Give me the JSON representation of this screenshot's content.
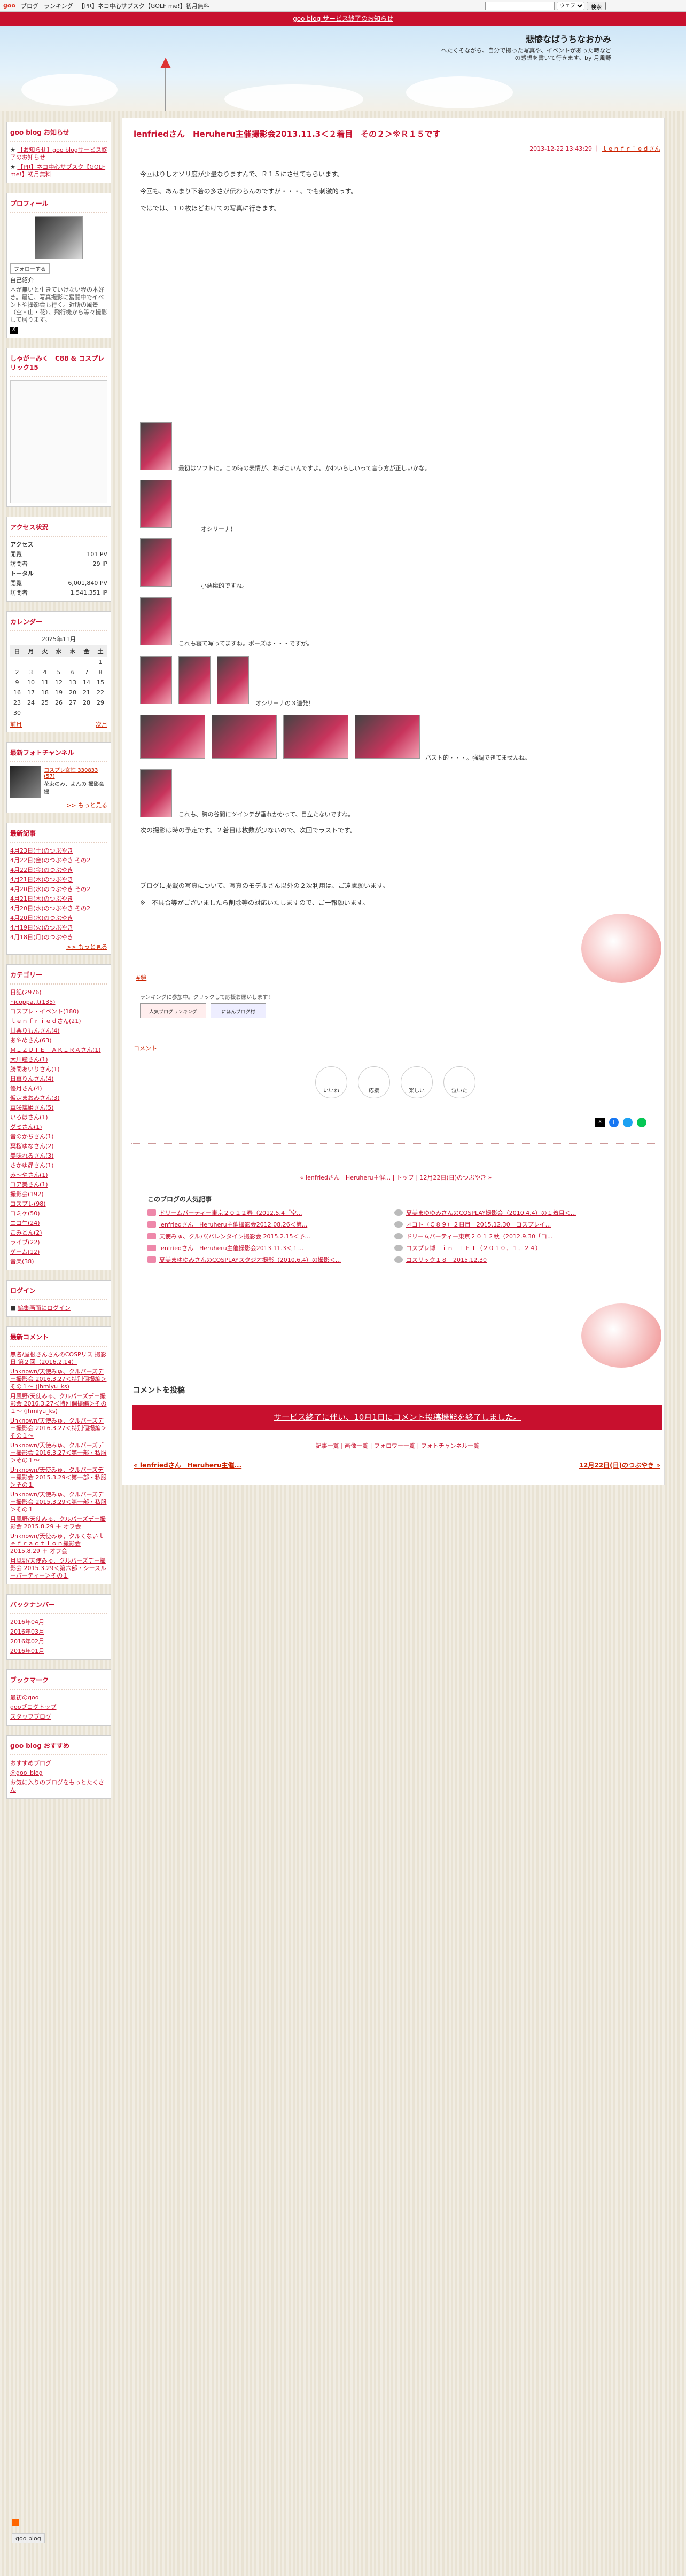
{
  "topbar": {
    "logo": "goo",
    "links": [
      "ブログ",
      "ランキング",
      "【PR】ネコ中心サブスク【GOLF me!】初月無料"
    ],
    "search_select": "ウェブ",
    "search_button": "検索"
  },
  "notice": "goo blog サービス終了のお知らせ",
  "header": {
    "title": "悲惨なばうちなおかみ",
    "description": "へたくそながら、自分で撮った写真や、イベントがあった時などの感想を書いて行きます。by 月風野"
  },
  "sidebar": {
    "news": {
      "title": "goo blog お知らせ",
      "items": [
        "【お知らせ】goo blogサービス終了のお知らせ",
        "【PR】ネコ中心サブスク【GOLF me!】初月無料"
      ]
    },
    "profile": {
      "title": "プロフィール",
      "follow": "フォローする",
      "name_label": "自己紹介",
      "intro": "本が無いと生きていけない程の本好き。最近、写真撮影に奮闘中でイベントや撮影会も行く。近所の風景（空・山・花）、飛行機から等々撮影して居ります。"
    },
    "banner": {
      "title": "しゃがーみく　C88 & コスプレリック15"
    },
    "access": {
      "title": "アクセス状況",
      "access_label": "アクセス",
      "total_label": "トータル",
      "rows": [
        [
          "閲覧",
          "101 PV"
        ],
        [
          "訪問者",
          "29 IP"
        ],
        [
          "閲覧",
          "6,001,840 PV"
        ],
        [
          "訪問者",
          "1,541,351 IP"
        ]
      ]
    },
    "calendar": {
      "title": "カレンダー",
      "month": "2025年11月",
      "days": [
        "日",
        "月",
        "火",
        "水",
        "木",
        "金",
        "土"
      ],
      "weeks": [
        [
          "",
          "",
          "",
          "",
          "",
          "",
          "1"
        ],
        [
          "2",
          "3",
          "4",
          "5",
          "6",
          "7",
          "8"
        ],
        [
          "9",
          "10",
          "11",
          "12",
          "13",
          "14",
          "15"
        ],
        [
          "16",
          "17",
          "18",
          "19",
          "20",
          "21",
          "22"
        ],
        [
          "23",
          "24",
          "25",
          "26",
          "27",
          "28",
          "29"
        ],
        [
          "30",
          "",
          "",
          "",
          "",
          "",
          ""
        ]
      ],
      "prev": "前月",
      "next": "次月"
    },
    "photo": {
      "title": "最新フォトチャンネル",
      "caption": "コスプレ女性 330833 (57)",
      "sub": "花束のみ、よんの 撮影会撮",
      "more": ">> もっと見る"
    },
    "recent": {
      "title": "最新記事",
      "items": [
        "4月23日(土)のつぶやき",
        "4月22日(金)のつぶやき その2",
        "4月22日(金)のつぶやき",
        "4月21日(木)のつぶやき",
        "4月20日(水)のつぶやき その2",
        "4月21日(木)のつぶやき",
        "4月20日(水)のつぶやき その2",
        "4月20日(水)のつぶやき",
        "4月19日(火)のつぶやき",
        "4月18日(月)のつぶやき"
      ],
      "more": ">> もっと見る"
    },
    "categories": {
      "title": "カテゴリー",
      "items": [
        "日記(2976)",
        "nicoppa..t(135)",
        "コスプレ・イベント(180)",
        "ｌｅｎｆｒｉｅｄさん(21)",
        "甘栗りもんさん(4)",
        "あやめさん(63)",
        "ＭＩＺＵＴＥ　ＡＫＩＲＡさん(1)",
        "大川瞳さん(1)",
        "勝間あいりさん(1)",
        "日暮りんさん(4)",
        "優月さん(4)",
        "仮定まおみさん(3)",
        "華咲璃姫さん(5)",
        "いろはさん(1)",
        "グミさん(1)",
        "音のかちさん(1)",
        "葉桜ゆなさん(2)",
        "美味れるさん(3)",
        "さかゆ昴さん(1)",
        "み～やさん(1)",
        "コア美さん(1)",
        "撮影会(192)",
        "コスプレ(98)",
        "コミケ(50)",
        "ニコ生(24)",
        "こみとん(2)",
        "ライブ(22)",
        "ゲーム(12)",
        "音楽(38)"
      ]
    },
    "login": {
      "title": "ログイン",
      "link": "編集画面にログイン"
    },
    "comments": {
      "title": "最新コメント",
      "items": [
        "無名/屋根さんさんのCOSPリス 撮影日 第２回（2016.2.14）",
        "Unknown/天使みゅ、クルパーズデー撮影会 2016.3.27＜特別個撮編＞その１～ (jhmiyu_ks)",
        "月風野/天使みゅ、クルパーズデー撮影会 2016.3.27＜特別個撮編＞その１～ (jhmiyu_ks)",
        "Unknown/天使みゅ、クルパーズデー撮影会 2016.3.27＜特別個撮編＞その１～",
        "Unknown/天使みゅ、クルパーズデー撮影会 2016.3.27＜第一部・私服＞その１～",
        "Unknown/天使みゅ、クルパーズデー撮影会 2015.3.29＜第一部・私服＞その１",
        "Unknown/天使みゅ、クルパーズデー撮影会 2015.3.29＜第一部・私服＞その１",
        "月風野/天使みゅ、クルパーズデー撮影会 2015.8.29 ＋ オフ会",
        "Unknown/天使みゅ、クルくないｌｅｆｒａｃｔｉｏｎ撮影会 2015.8.29 ＋ オフ会",
        "月風野/天使みゅ、クルパーズデー撮影会 2015.3.29＜第六部・シースルーパーティー＞その１"
      ]
    },
    "backnumber": {
      "title": "バックナンバー",
      "items": [
        "2016年04月",
        "2016年03月",
        "2016年02月",
        "2016年01月"
      ]
    },
    "bookmark": {
      "title": "ブックマーク",
      "items": [
        "最初のgoo",
        "gooブログトップ",
        "スタッフブログ"
      ]
    },
    "osusume": {
      "title": "goo blog おすすめ",
      "items": [
        "おすすめブログ",
        "@goo_blog",
        "お気に入りのブログをもっとたくさん"
      ]
    }
  },
  "entry": {
    "title": "lenfriedさん　Heruheru主催撮影会2013.11.3＜２着目　その２＞※Ｒ１５です",
    "date": "2013-12-22 13:43:29",
    "author": "ｌｅｎｆｒｉｅｄさん",
    "paras": [
      "今回はりしオソリ度が少量なりますんで、Ｒ１５にさせてもらいます。",
      "今回も、あんまり下着の多さが伝わらんのですが・・・、でも刺激的っす。",
      "ではでは、１０枚ほどおけての写真に行きます。"
    ],
    "captions": [
      "最初はソフトに。この時の表情が、おぼこいんですよ。かわいらしいって言う方が正しいかな。",
      "オシリーナ！",
      "小悪魔的ですね。",
      "これも寝て写ってますね。ポーズは・・・ですが。",
      "オシリーナの３連発！",
      "バスト的・・・。強調できてませんね。",
      "これも、胸の谷間にツインテが垂れかかって、目立たないですね。"
    ],
    "closing": "次の撮影は時の予定です。２着目は枚数が少ないので、次回でラストです。",
    "notes": [
      "ブログに掲載の写真について、写真のモデルさん以外の２次利用は、ご遠慮願います。",
      "※　不具合等がございましたら削除等の対応いたしますので、ご一報願います。"
    ],
    "tag": "#鏡",
    "rank_text": "ランキングに参加中。クリックして応援お願いします！",
    "rank1": "人気ブログランキング",
    "rank2": "にほんブログ村",
    "comment_link": "コメント"
  },
  "reactions": [
    "いいね",
    "応援",
    "楽しい",
    "泣いた"
  ],
  "pager": "« lenfriedさん　Heruheru主催... | トップ | 12月22日(日)のつぶやき »",
  "popular": {
    "title": "このブログの人気記事",
    "items": [
      "ドリームパーティー東京２０１２春（2012.5.4「空...",
      "lenfriedさん　Heruheru主催撮影会2012.08.26＜第...",
      "天使みゅ、クルパ(バレンタイン撮影会 2015.2.15＜予...",
      "lenfriedさん　Heruheru主催撮影会2013.11.3＜１...",
      "夏美まゆゆみさんのCOSPLAYスタジオ撮影（2010.6.4）の撮影＜...",
      "夏美まゆゆみさんのCOSPLAY撮影会（2010.4.4）の１着目＜...",
      "ネコト（Ｃ８９）２日目　2015.12.30　コスプレイ...",
      "ドリームパーティー東京２０１２秋（2012.9.30「コ...",
      "コスプレ博　ｉｎ　ＴＦＴ（２０１０．１．２４）",
      "コスリック１８　2015.12.30"
    ]
  },
  "post": {
    "title": "コメントを投稿",
    "notice": "サービス終了に伴い、10月1日にコメント投稿機能を終了しました。",
    "links": "記事一覧 | 画像一覧 | フォロワー一覧 | フォトチャンネル一覧",
    "prev": "« lenfriedさん　Heruheru主催...",
    "next": "12月22日(日)のつぶやき »"
  }
}
